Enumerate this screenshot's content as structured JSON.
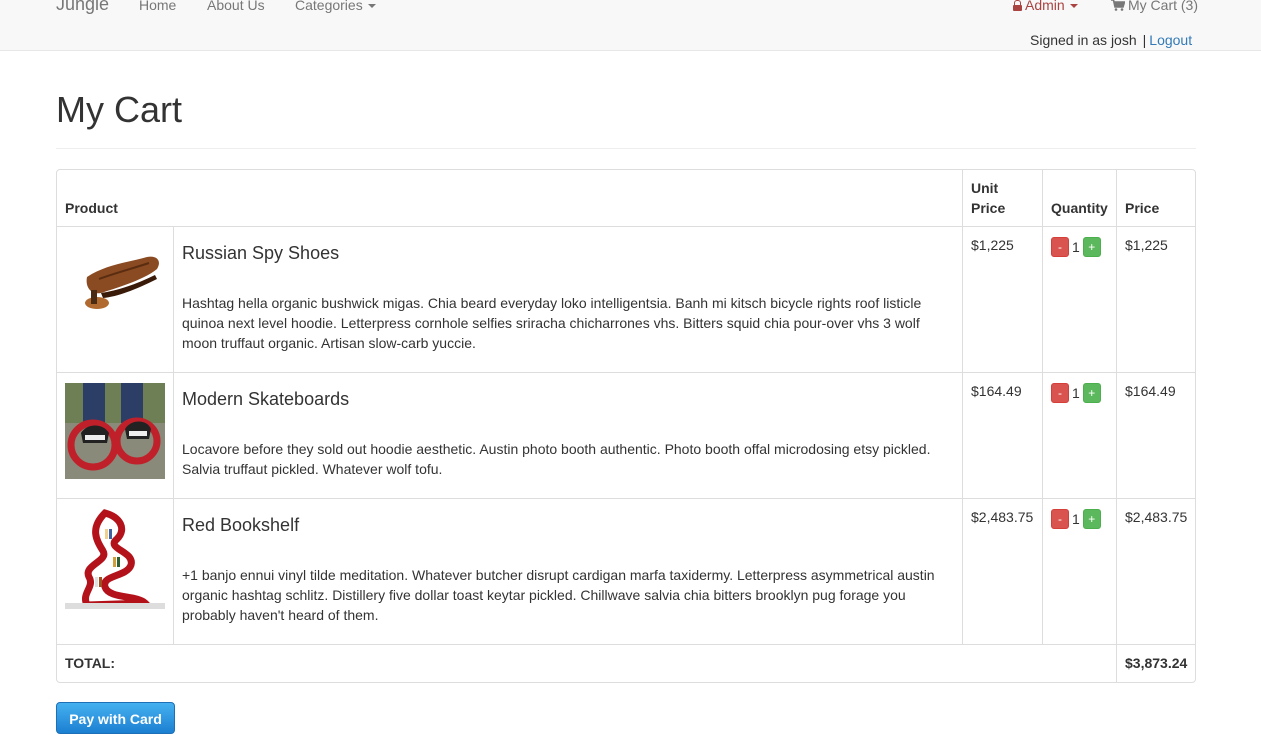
{
  "navbar": {
    "brand": "Jungle",
    "links": [
      "Home",
      "About Us",
      "Categories"
    ],
    "admin": "Admin",
    "cart": "My Cart (3)",
    "signed_in": "Signed in as josh",
    "separator": "|",
    "logout": "Logout"
  },
  "page": {
    "title": "My Cart"
  },
  "table": {
    "headers": {
      "product": "Product",
      "unit_price": [
        "Unit",
        "Price"
      ],
      "quantity": "Quantity",
      "price": "Price"
    },
    "items": [
      {
        "name": "Russian Spy Shoes",
        "description": "Hashtag hella organic bushwick migas. Chia beard everyday loko intelligentsia. Banh mi kitsch bicycle rights roof listicle quinoa next level hoodie. Letterpress cornhole selfies sriracha chicharrones vhs. Bitters squid chia pour-over vhs 3 wolf moon truffaut organic. Artisan slow-carb yuccie.",
        "unit_price": "$1,225",
        "quantity": "1",
        "price": "$1,225"
      },
      {
        "name": "Modern Skateboards",
        "description": "Locavore before they sold out hoodie aesthetic. Austin photo booth authentic. Photo booth offal microdosing etsy pickled. Salvia truffaut pickled. Whatever wolf tofu.",
        "unit_price": "$164.49",
        "quantity": "1",
        "price": "$164.49"
      },
      {
        "name": "Red Bookshelf",
        "description": "+1 banjo ennui vinyl tilde meditation. Whatever butcher disrupt cardigan marfa taxidermy. Letterpress asymmetrical austin organic hashtag schlitz. Distillery five dollar toast keytar pickled. Chillwave salvia chia bitters brooklyn pug forage you probably haven't heard of them.",
        "unit_price": "$2,483.75",
        "quantity": "1",
        "price": "$2,483.75"
      }
    ],
    "qty_minus": "-",
    "qty_plus": "+",
    "total_label": "TOTAL:",
    "total_value": "$3,873.24"
  },
  "pay_button": "Pay with Card",
  "colors": {
    "danger": "#d9534f",
    "success": "#5cb85c",
    "link": "#337ab7",
    "admin": "#a94442",
    "pay": "#2a8fe0"
  }
}
